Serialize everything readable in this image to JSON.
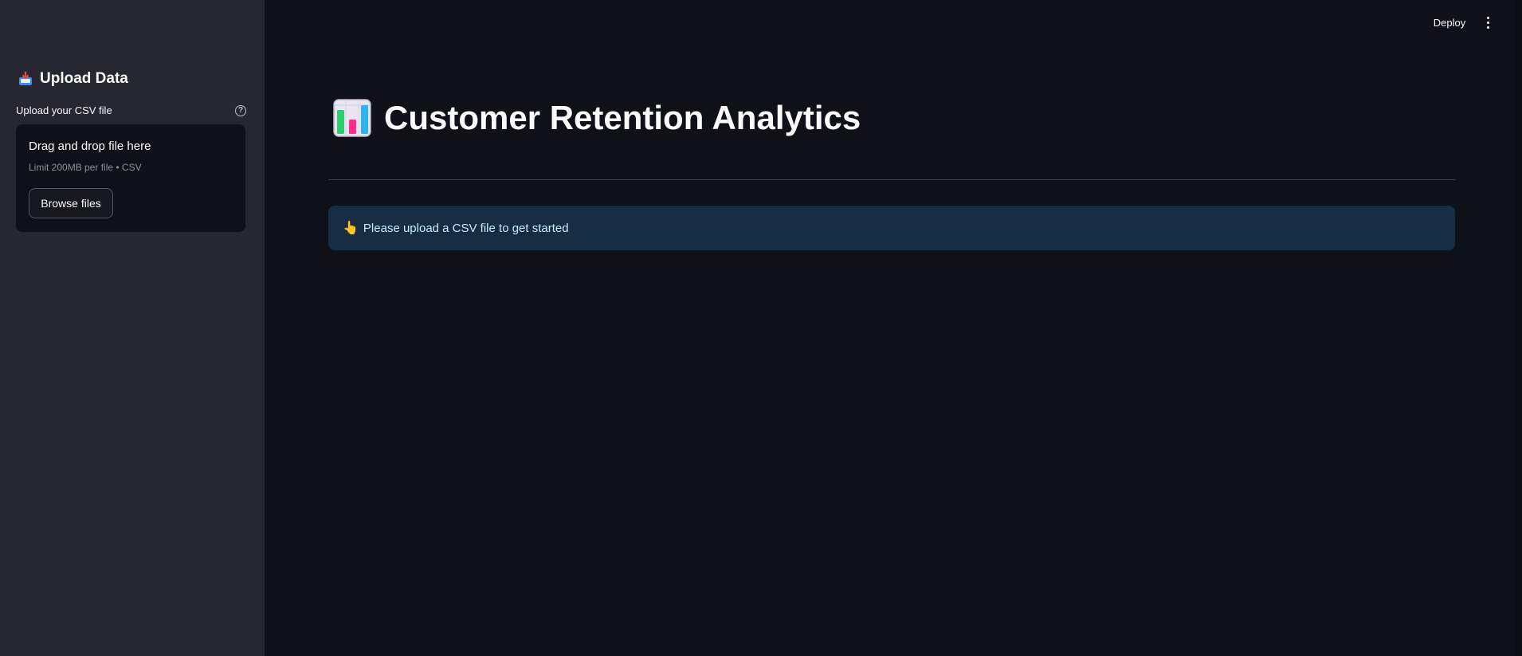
{
  "sidebar": {
    "title": "Upload Data",
    "title_icon": "inbox-tray-icon",
    "uploader": {
      "label": "Upload your CSV file",
      "help_icon": "question-circle-icon",
      "dropzone_title": "Drag and drop file here",
      "limit_text": "Limit 200MB per file • CSV",
      "browse_label": "Browse files"
    }
  },
  "header": {
    "deploy_label": "Deploy",
    "menu_icon": "vertical-ellipsis-icon"
  },
  "main": {
    "title_icon": "bar-chart-icon",
    "title": "Customer Retention Analytics",
    "info": {
      "icon": "pointing-up-hand-icon",
      "text": "Please upload a CSV file to get started"
    }
  },
  "colors": {
    "sidebar_bg": "#262730",
    "main_bg": "#0e1117",
    "info_bg": "#172d43",
    "info_text": "#c7ebff"
  }
}
